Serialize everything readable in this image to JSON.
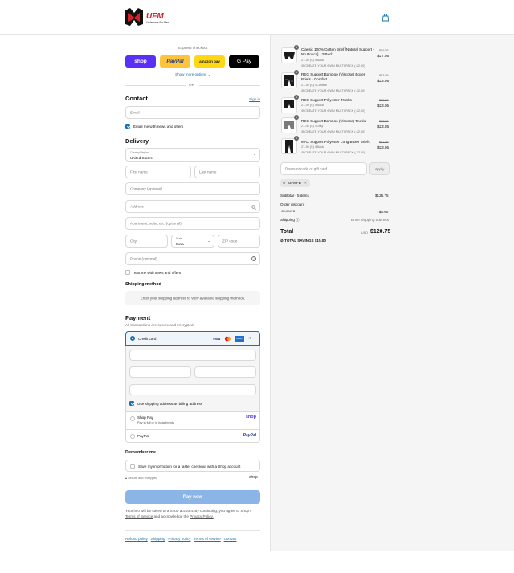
{
  "brand": {
    "logo_text": "UFM",
    "tagline": "Underwear For Men",
    "accent": "#d2232a"
  },
  "express": {
    "title": "Express checkout",
    "shop": "shop",
    "paypal": "PayPal",
    "amazon": "amazon pay",
    "gpay": "G Pay",
    "more": "Show more options",
    "or": "OR"
  },
  "contact": {
    "title": "Contact",
    "sign_in": "Sign in",
    "email_ph": "Email",
    "news_label": "Email me with news and offers"
  },
  "delivery": {
    "title": "Delivery",
    "country_label": "Country/Region",
    "country": "United States",
    "first_ph": "First name",
    "last_ph": "Last name",
    "company_ph": "Company (optional)",
    "address_ph": "Address",
    "apt_ph": "Apartment, suite, etc. (optional)",
    "city_ph": "City",
    "state_label": "State",
    "state": "Iowa",
    "zip_ph": "ZIP code",
    "phone_ph": "Phone (optional)",
    "text_label": "Text me with news and offers"
  },
  "shipping_method": {
    "title": "Shipping method",
    "notice": "Enter your shipping address to view available shipping methods."
  },
  "payment": {
    "title": "Payment",
    "subtitle": "All transactions are secure and encrypted.",
    "credit_label": "Credit card",
    "visa": "VISA",
    "amex": "AMEX",
    "more_cards": "+7",
    "billing_label": "Use shipping address as billing address",
    "shop_pay": "Shop Pay",
    "shop_pay_sub": "Pay in full or in installments",
    "shop_pay_logo": "shop",
    "paypal": "PayPal"
  },
  "remember": {
    "title": "Remember me",
    "save_label": "Save my information for a faster checkout with a Shop account",
    "secure": "Secure and encrypted",
    "shop": "shop"
  },
  "pay_button": "Pay now",
  "legal": {
    "line1": "Your info will be saved to a Shop account. By continuing, you agree to Shop's",
    "terms": "Terms of Service",
    "mid": "and acknowledge the",
    "privacy": "Privacy Policy."
  },
  "footer_links": [
    "Refund policy",
    "Shipping",
    "Privacy policy",
    "Terms of service",
    "Contact"
  ],
  "items": [
    {
      "name": "Classic 100% Cotton Brief [Natural Support - No Pouch] - 3 Pack",
      "variant": "27-30 (S) / Black",
      "promo": "CREATE YOUR OWN MULTI-PACK (-$2.00)",
      "old": "$29.95",
      "price": "$27.95",
      "qty": "1"
    },
    {
      "name": "REG Support Bamboo (Viscose) Boxer Briefs - Comfort",
      "variant": "27-30 (S) / Confetti",
      "promo": "CREATE YOUR OWN MULTI-PACK (-$2.00)",
      "old": "$33.95",
      "price": "$23.95",
      "qty": "1"
    },
    {
      "name": "REG Support Polyester Trunks",
      "variant": "27-30 (S) / Black",
      "promo": "CREATE YOUR OWN MULTI-PACK (-$2.00)",
      "old": "$33.95",
      "price": "$23.95",
      "qty": "1"
    },
    {
      "name": "REG Support Bamboo (Viscose) Trunks",
      "variant": "27-30 (S) / Gray",
      "promo": "CREATE YOUR OWN MULTI-PACK (-$2.00)",
      "old": "$33.95",
      "price": "$23.95",
      "qty": "1"
    },
    {
      "name": "MAX Support Polyester Long Boxer Briefs",
      "variant": "27-30 (S) / Black",
      "promo": "CREATE YOUR OWN MULTI-PACK (-$2.00)",
      "old": "$27.95",
      "price": "$23.95",
      "qty": "1"
    }
  ],
  "discount": {
    "placeholder": "Discount code or gift card",
    "apply": "Apply",
    "code": "UFMFB"
  },
  "summary": {
    "subtotal_label": "Subtotal · 5 items",
    "subtotal": "$125.75",
    "order_discount": "Order discount",
    "code": "UFMFB",
    "discount": "- $5.00",
    "shipping_label": "Shipping",
    "shipping": "Enter shipping address",
    "total_label": "Total",
    "currency": "USD",
    "total": "$120.75",
    "savings_label": "TOTAL SAVINGS",
    "savings": "$15.00"
  }
}
